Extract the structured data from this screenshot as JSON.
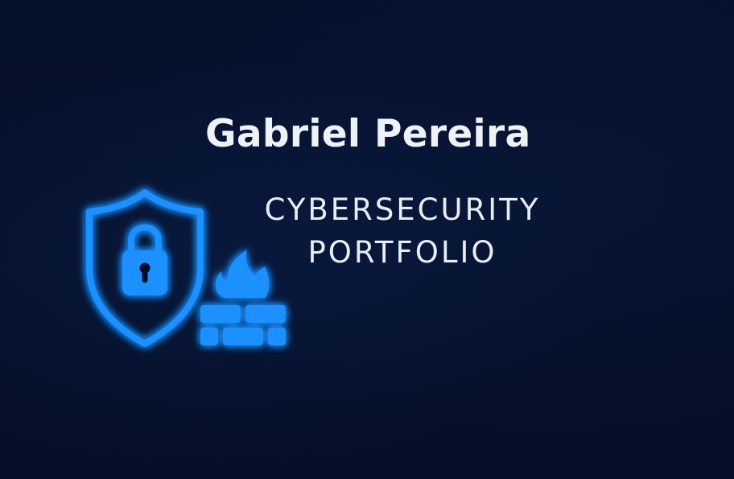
{
  "header": {
    "name": "Gabriel Pereira",
    "subtitle_line1": "CYBERSECURITY",
    "subtitle_line2": "PORTFOLIO"
  },
  "emblem": {
    "icons": [
      "shield-lock-icon",
      "padlock-icon",
      "flame-icon",
      "brick-wall-icon"
    ],
    "accent_color": "#1e90ff",
    "glow_color": "#38a8ff"
  },
  "colors": {
    "background": "#05102a",
    "text": "#eef1f6"
  }
}
